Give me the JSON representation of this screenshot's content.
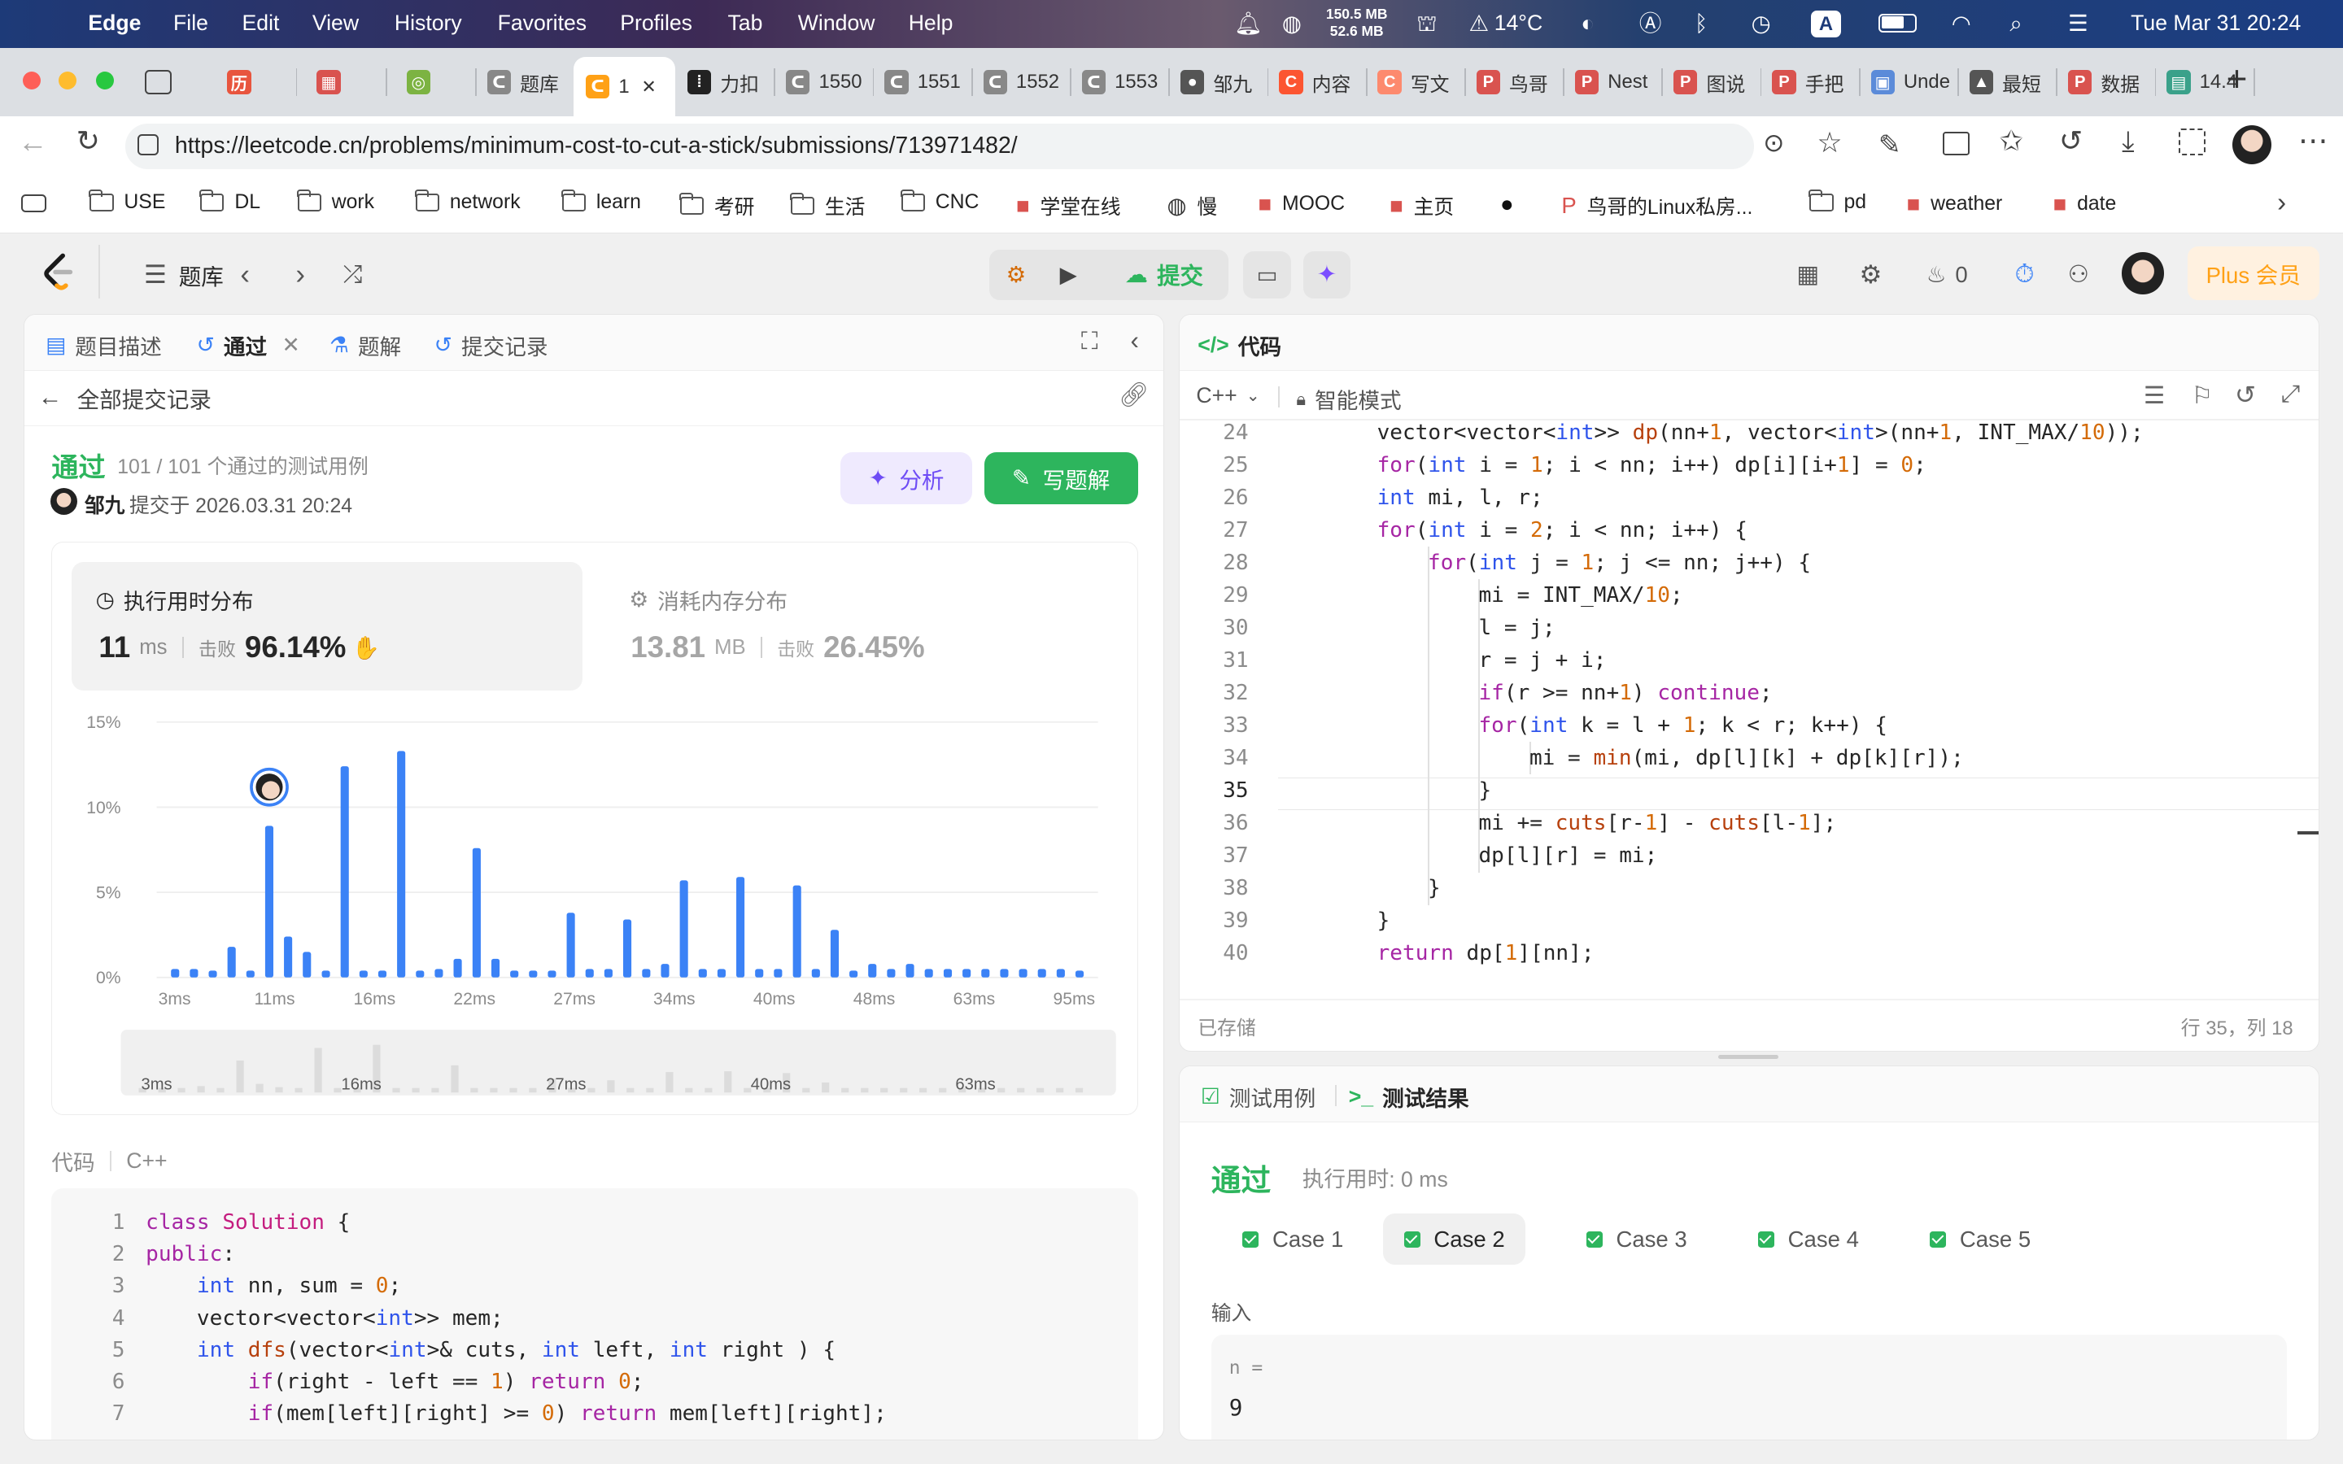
{
  "menubar": {
    "items": [
      "Edge",
      "File",
      "Edit",
      "View",
      "History",
      "Favorites",
      "Profiles",
      "Tab",
      "Window",
      "Help"
    ],
    "mem_top": "150.5 MB",
    "mem_bottom": "52.6 MB",
    "weather": "14°C",
    "input_method": "A",
    "datetime": "Tue Mar 31  20:24"
  },
  "tabs": [
    {
      "label": "",
      "icon": "history-red-icon"
    },
    {
      "label": "",
      "icon": "calendar-icon"
    },
    {
      "label": "",
      "icon": "multicolor-ring-icon"
    },
    {
      "label": "题库",
      "icon": "leetcode-gray-icon"
    },
    {
      "label": "1",
      "icon": "leetcode-icon",
      "active": true
    },
    {
      "label": "力扣",
      "icon": "dots-icon"
    },
    {
      "label": "1550",
      "icon": "leetcode-gray-icon"
    },
    {
      "label": "1551",
      "icon": "leetcode-gray-icon"
    },
    {
      "label": "1552",
      "icon": "leetcode-gray-icon"
    },
    {
      "label": "1553",
      "icon": "leetcode-gray-icon"
    },
    {
      "label": "邹九",
      "icon": "avatar-icon"
    },
    {
      "label": "内容",
      "icon": "csdn-icon"
    },
    {
      "label": "写文",
      "icon": "csdn-light-icon"
    },
    {
      "label": "鸟哥",
      "icon": "pdf-icon"
    },
    {
      "label": "Nest",
      "icon": "pdf-icon"
    },
    {
      "label": "图说",
      "icon": "pdf-icon"
    },
    {
      "label": "手把",
      "icon": "pdf-icon"
    },
    {
      "label": "Unde",
      "icon": "box-icon"
    },
    {
      "label": "最短",
      "icon": "cap-icon"
    },
    {
      "label": "数据",
      "icon": "pdf-icon"
    },
    {
      "label": "14.4",
      "icon": "chart-icon"
    }
  ],
  "address": {
    "url": "https://leetcode.cn/problems/minimum-cost-to-cut-a-stick/submissions/713971482/"
  },
  "bookmarks": [
    {
      "label": "USE",
      "type": "folder"
    },
    {
      "label": "DL",
      "type": "folder"
    },
    {
      "label": "work",
      "type": "folder"
    },
    {
      "label": "network",
      "type": "folder"
    },
    {
      "label": "learn",
      "type": "folder"
    },
    {
      "label": "考研",
      "type": "folder"
    },
    {
      "label": "生活",
      "type": "folder"
    },
    {
      "label": "CNC",
      "type": "folder"
    },
    {
      "label": "学堂在线",
      "type": "site"
    },
    {
      "label": "慢",
      "type": "globe"
    },
    {
      "label": "MOOC",
      "type": "site"
    },
    {
      "label": "主页",
      "type": "site"
    },
    {
      "label": "",
      "type": "github"
    },
    {
      "label": "鸟哥的Linux私房...",
      "type": "pdf"
    },
    {
      "label": "pd",
      "type": "folder"
    },
    {
      "label": "weather",
      "type": "site"
    },
    {
      "label": "date",
      "type": "site"
    }
  ],
  "lcnav": {
    "problem_bank": "题库",
    "submit": "提交",
    "streak": "0",
    "plus": "Plus 会员"
  },
  "left_panel": {
    "tabs": [
      "题目描述",
      "通过",
      "题解",
      "提交记录"
    ],
    "back_label": "全部提交记录",
    "status": "通过",
    "passed_text": "101 / 101 个通过的测试用例",
    "user": "邹九",
    "submitted_at": "提交于 2026.03.31 20:24",
    "analyze_btn": "分析",
    "write_btn": "写题解",
    "runtime": {
      "title": "执行用时分布",
      "value": "11",
      "unit": "ms",
      "beat_label": "击败",
      "beat": "96.14%"
    },
    "memory": {
      "title": "消耗内存分布",
      "value": "13.81",
      "unit": "MB",
      "beat_label": "击败",
      "beat": "26.45%"
    },
    "code_label": "代码",
    "code_lang": "C++"
  },
  "chart_data": {
    "type": "bar",
    "title": "执行用时分布",
    "ylim": [
      0,
      15
    ],
    "yticks": [
      "15%",
      "10%",
      "5%",
      "0%"
    ],
    "xticks": [
      "3ms",
      "11ms",
      "16ms",
      "22ms",
      "27ms",
      "34ms",
      "40ms",
      "48ms",
      "63ms",
      "95ms"
    ],
    "user_bin_index": 6,
    "values": [
      0.5,
      0.5,
      0.4,
      1.8,
      0.4,
      8.9,
      2.4,
      1.5,
      0.4,
      12.4,
      0.4,
      0.4,
      13.3,
      0.4,
      0.5,
      1.1,
      7.6,
      1.1,
      0.4,
      0.4,
      0.4,
      3.8,
      0.5,
      0.5,
      3.4,
      0.5,
      0.8,
      5.7,
      0.5,
      0.5,
      5.9,
      0.5,
      0.5,
      5.4,
      0.5,
      2.8,
      0.4,
      0.8,
      0.5,
      0.8,
      0.5,
      0.5,
      0.5,
      0.5,
      0.5,
      0.5,
      0.5,
      0.5,
      0.4
    ],
    "mini_ticks": [
      "3ms",
      "16ms",
      "27ms",
      "40ms",
      "63ms"
    ]
  },
  "bottom_code": [
    {
      "n": "1",
      "html": "<span class='kw'>class</span> <span class='cls'>Solution</span> {"
    },
    {
      "n": "2",
      "html": "<span class='kw'>public</span>:"
    },
    {
      "n": "3",
      "html": "    <span class='ty'>int</span> nn, sum = <span class='nm'>0</span>;"
    },
    {
      "n": "4",
      "html": "    vector&lt;vector&lt;<span class='ty'>int</span>&gt;&gt; mem;"
    },
    {
      "n": "5",
      "html": "    <span class='ty'>int</span> <span class='fn'>dfs</span>(vector&lt;<span class='ty'>int</span>&gt;&amp; cuts, <span class='ty'>int</span> left, <span class='ty'>int</span> right ) {"
    },
    {
      "n": "6",
      "html": "        <span class='kw'>if</span>(right - left == <span class='nm'>1</span>) <span class='kw'>return</span> <span class='nm'>0</span>;"
    },
    {
      "n": "7",
      "html": "        <span class='kw'>if</span>(mem[left][right] &gt;= <span class='nm'>0</span>) <span class='kw'>return</span> mem[left][right];"
    }
  ],
  "right_panel": {
    "title": "代码",
    "lang": "C++",
    "mode": "智能模式",
    "saved": "已存储",
    "cursor": "行 35，列 18",
    "code": [
      {
        "n": "24",
        "indent": 2,
        "html": "vector&lt;vector&lt;<span class='ty'>int</span>&gt;&gt; <span class='fn'>dp</span>(nn+<span class='nm'>1</span>, vector&lt;<span class='ty'>int</span>&gt;(nn+<span class='nm'>1</span>, INT_MAX/<span class='nm'>10</span>));"
      },
      {
        "n": "25",
        "indent": 2,
        "html": "<span class='kw'>for</span>(<span class='ty'>int</span> i = <span class='nm'>1</span>; i &lt; nn; i++) dp[i][i+<span class='nm'>1</span>] = <span class='nm'>0</span>;"
      },
      {
        "n": "26",
        "indent": 2,
        "html": "<span class='ty'>int</span> mi, l, r;"
      },
      {
        "n": "27",
        "indent": 2,
        "html": "<span class='kw'>for</span>(<span class='ty'>int</span> i = <span class='nm'>2</span>; i &lt; nn; i++) {"
      },
      {
        "n": "28",
        "indent": 3,
        "html": "<span class='kw'>for</span>(<span class='ty'>int</span> j = <span class='nm'>1</span>; j &lt;= nn; j++) {"
      },
      {
        "n": "29",
        "indent": 4,
        "html": "mi = INT_MAX/<span class='nm'>10</span>;"
      },
      {
        "n": "30",
        "indent": 4,
        "html": "l = j;"
      },
      {
        "n": "31",
        "indent": 4,
        "html": "r = j + i;"
      },
      {
        "n": "32",
        "indent": 4,
        "html": "<span class='kw'>if</span>(r &gt;= nn+<span class='nm'>1</span>) <span class='kw'>continue</span>;"
      },
      {
        "n": "33",
        "indent": 4,
        "html": "<span class='kw'>for</span>(<span class='ty'>int</span> k = l + <span class='nm'>1</span>; k &lt; r; k++) {"
      },
      {
        "n": "34",
        "indent": 5,
        "html": "mi = <span class='fn'>min</span>(mi, dp[l][k] + dp[k][r]);"
      },
      {
        "n": "35",
        "indent": 4,
        "html": "}"
      },
      {
        "n": "36",
        "indent": 4,
        "html": "mi += <span class='fn'>cuts</span>[r-<span class='nm'>1</span>] - <span class='fn'>cuts</span>[l-<span class='nm'>1</span>];"
      },
      {
        "n": "37",
        "indent": 4,
        "html": "dp[l][r] = mi;"
      },
      {
        "n": "38",
        "indent": 3,
        "html": "}"
      },
      {
        "n": "39",
        "indent": 2,
        "html": "}"
      },
      {
        "n": "40",
        "indent": 2,
        "html": "<span class='kw'>return</span> dp[<span class='nm'>1</span>][nn];"
      }
    ]
  },
  "test_panel": {
    "tab_cases": "测试用例",
    "tab_result": "测试结果",
    "status": "通过",
    "runtime": "执行用时: 0 ms",
    "cases": [
      "Case 1",
      "Case 2",
      "Case 3",
      "Case 4",
      "Case 5"
    ],
    "selected_case": 1,
    "input_label": "输入",
    "var_name": "n =",
    "var_value": "9"
  },
  "colors": {
    "accent_blue": "#3b82f6",
    "pass_green": "#2db55d",
    "submit_green": "#2db55d",
    "plus_orange": "#ffa116"
  }
}
